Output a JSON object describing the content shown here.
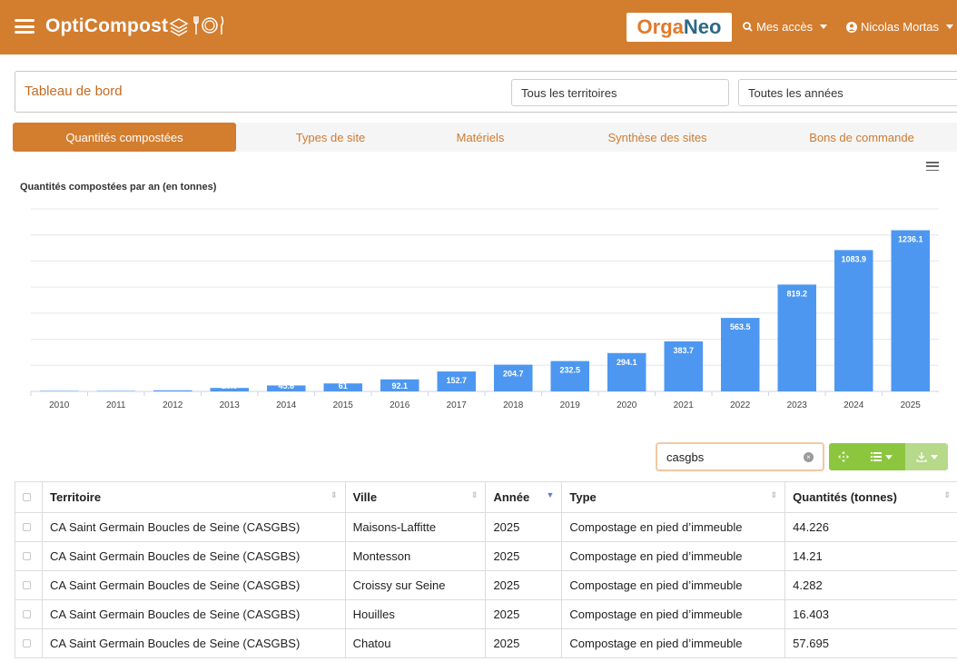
{
  "header": {
    "brand": "OptiCompost",
    "partner_logo_part1": "Orga",
    "partner_logo_part2": "Neo",
    "access_label": "Mes accès",
    "user_label": "Nicolas Mortas"
  },
  "toolbar": {
    "title": "Tableau de bord",
    "territory_select": "Tous les territoires",
    "year_select": "Toutes les années"
  },
  "tabs": [
    {
      "label": "Quantités compostées",
      "active": true
    },
    {
      "label": "Types de site",
      "active": false
    },
    {
      "label": "Matériels",
      "active": false
    },
    {
      "label": "Synthèse des sites",
      "active": false
    },
    {
      "label": "Bons de commande",
      "active": false
    }
  ],
  "chart_data": {
    "type": "bar",
    "title": "Quantités compostées par an (en tonnes)",
    "categories": [
      "2010",
      "2011",
      "2012",
      "2013",
      "2014",
      "2015",
      "2016",
      "2017",
      "2018",
      "2019",
      "2020",
      "2021",
      "2022",
      "2023",
      "2024",
      "2025"
    ],
    "values": [
      0.3,
      1.2,
      8.2,
      26.5,
      45.6,
      61,
      92.1,
      152.7,
      204.7,
      232.5,
      294.1,
      383.7,
      563.5,
      819.2,
      1083.9,
      1236.1
    ],
    "data_labels": [
      "",
      "",
      "",
      "26.5",
      "45.6",
      "61",
      "92.1",
      "152.7",
      "204.7",
      "232.5",
      "294.1",
      "383.7",
      "563.5",
      "819.2",
      "1083.9",
      "1236.1"
    ],
    "ylim": [
      0,
      1400
    ],
    "grid": true,
    "color": "#4d97f0"
  },
  "search": {
    "value": "casgbs"
  },
  "table": {
    "columns": [
      "Territoire",
      "Ville",
      "Année",
      "Type",
      "Quantités (tonnes)"
    ],
    "rows": [
      [
        "CA Saint Germain Boucles de Seine (CASGBS)",
        "Maisons-Laffitte",
        "2025",
        "Compostage en pied d’immeuble",
        "44.226"
      ],
      [
        "CA Saint Germain Boucles de Seine (CASGBS)",
        "Montesson",
        "2025",
        "Compostage en pied d’immeuble",
        "14.21"
      ],
      [
        "CA Saint Germain Boucles de Seine (CASGBS)",
        "Croissy sur Seine",
        "2025",
        "Compostage en pied d’immeuble",
        "4.282"
      ],
      [
        "CA Saint Germain Boucles de Seine (CASGBS)",
        "Houilles",
        "2025",
        "Compostage en pied d’immeuble",
        "16.403"
      ],
      [
        "CA Saint Germain Boucles de Seine (CASGBS)",
        "Chatou",
        "2025",
        "Compostage en pied d’immeuble",
        "57.695"
      ]
    ]
  },
  "colors": {
    "brand": "#d37d2f",
    "bar": "#4d97f0",
    "green": "#8cc63f"
  }
}
